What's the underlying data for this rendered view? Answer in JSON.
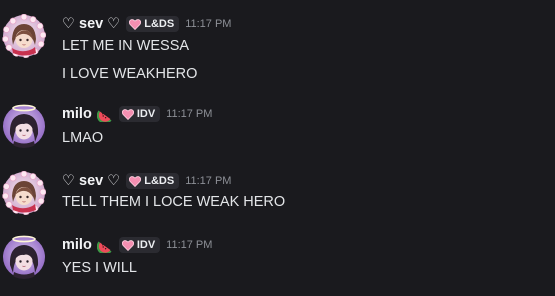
{
  "messages": [
    {
      "username": "♡ sev ♡",
      "tag": "L&DS",
      "time": "11:17 PM",
      "lines": [
        "LET ME IN WESSA",
        "I LOVE WEAKHERO"
      ]
    },
    {
      "username": "milo",
      "tag": "IDV",
      "time": "11:17 PM",
      "lines": [
        "LMAO"
      ]
    },
    {
      "username": "♡ sev ♡",
      "tag": "L&DS",
      "time": "11:17 PM",
      "lines": [
        "TELL THEM I LOCE WEAK HERO"
      ]
    },
    {
      "username": "milo",
      "tag": "IDV",
      "time": "11:17 PM",
      "lines": [
        "YES I WILL"
      ]
    }
  ],
  "icons": {
    "tag_icon": "heart-icon",
    "milo_emoji": "watermelon-icon"
  },
  "colors": {
    "background": "#1a1a1e",
    "tag_heart": "#f48fb1",
    "timestamp": "#8d9097"
  }
}
